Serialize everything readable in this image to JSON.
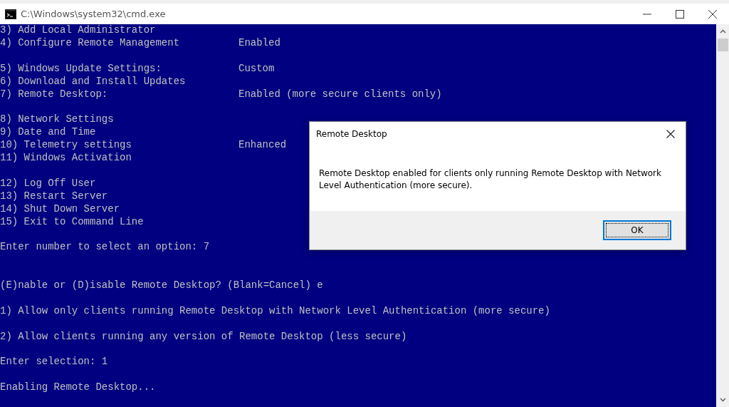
{
  "window": {
    "title": "C:\\Windows\\system32\\cmd.exe"
  },
  "console": {
    "blocks": [
      [
        {
          "text": "3) Add Local Administrator"
        },
        {
          "text": "4) Configure Remote Management",
          "value": "Enabled"
        }
      ],
      [
        {
          "text": "5) Windows Update Settings:",
          "value": "Custom"
        },
        {
          "text": "6) Download and Install Updates"
        },
        {
          "text": "7) Remote Desktop:",
          "value": "Enabled (more secure clients only)"
        }
      ],
      [
        {
          "text": "8) Network Settings"
        },
        {
          "text": "9) Date and Time"
        },
        {
          "text": "10) Telemetry settings",
          "value": "Enhanced"
        },
        {
          "text": "11) Windows Activation"
        }
      ],
      [
        {
          "text": "12) Log Off User"
        },
        {
          "text": "13) Restart Server"
        },
        {
          "text": "14) Shut Down Server"
        },
        {
          "text": "15) Exit to Command Line"
        }
      ],
      [
        {
          "text": "Enter number to select an option: 7"
        }
      ],
      [
        {
          "text": "(E)nable or (D)isable Remote Desktop? (Blank=Cancel) e"
        }
      ],
      [
        {
          "text": "1) Allow only clients running Remote Desktop with Network Level Authentication (more secure)"
        }
      ],
      [
        {
          "text": "2) Allow clients running any version of Remote Desktop (less secure)"
        }
      ],
      [
        {
          "text": "Enter selection: 1"
        }
      ],
      [
        {
          "text": "Enabling Remote Desktop..."
        }
      ]
    ]
  },
  "dialog": {
    "title": "Remote Desktop",
    "message": "Remote Desktop enabled for clients only running Remote Desktop with Network Level Authentication (more secure).",
    "button": "OK"
  }
}
